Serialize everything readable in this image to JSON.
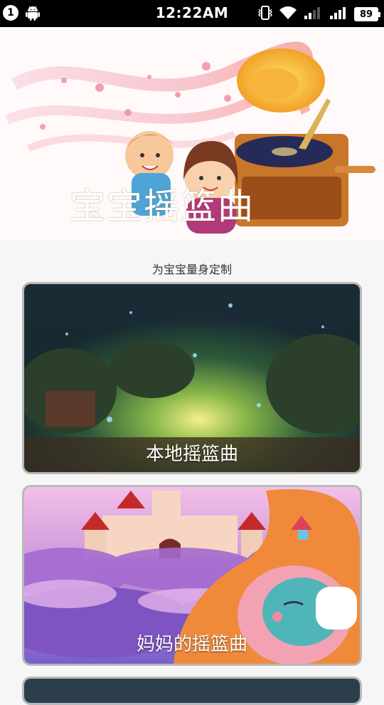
{
  "status_bar": {
    "notification_count": "1",
    "time": "12:22AM",
    "battery": "89",
    "icons": [
      "android-icon",
      "vibrate-icon",
      "wifi-icon",
      "signal-icon",
      "signal-icon",
      "battery-icon"
    ]
  },
  "banner": {
    "title": "宝宝摇篮曲"
  },
  "subtitle": "为宝宝量身定制",
  "cards": [
    {
      "label": "本地摇篮曲"
    },
    {
      "label": "妈妈的摇篮曲"
    }
  ]
}
